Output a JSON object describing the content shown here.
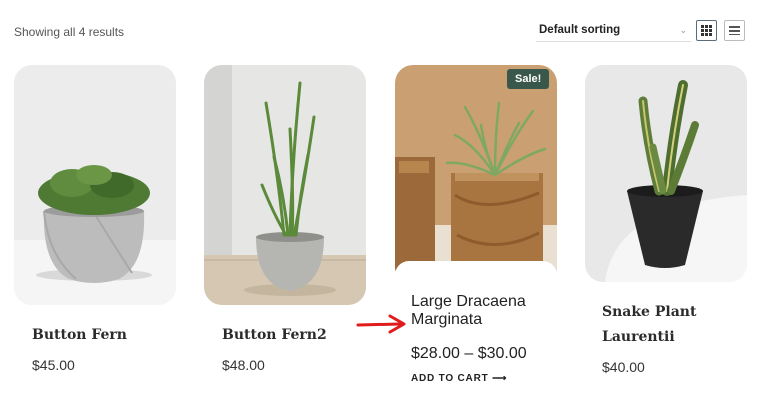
{
  "toolbar": {
    "result_count": "Showing all 4 results",
    "sorting_selected": "Default sorting",
    "grid_view_icon": "grid-icon",
    "list_view_icon": "list-icon"
  },
  "products": [
    {
      "title": "Button Fern",
      "price": "$45.00"
    },
    {
      "title": "Button Fern2",
      "price": "$48.00"
    },
    {
      "title_line1": "Large Dracaena",
      "title_line2": "Marginata",
      "price": "$28.00 – $30.00",
      "badge": "Sale!",
      "cta": "ADD TO CART",
      "cta_icon": "arrow-right-icon"
    },
    {
      "title_line1": "Snake Plant",
      "title_line2": "Laurentii",
      "price": "$40.00"
    }
  ],
  "colors": {
    "badge_bg": "#39584b",
    "annotation_arrow": "#e01b1b"
  }
}
